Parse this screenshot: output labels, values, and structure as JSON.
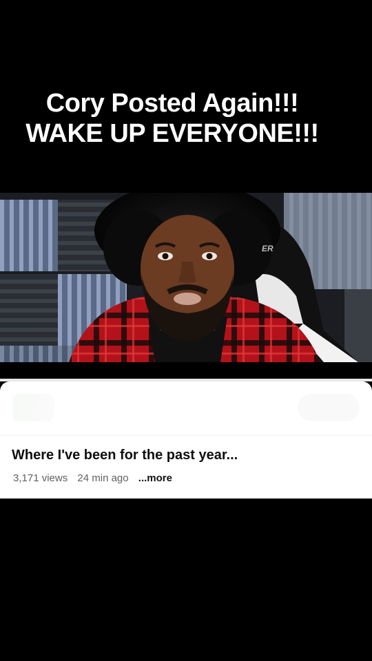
{
  "overlay_caption": {
    "line1": "Cory Posted Again!!!",
    "line2": "WAKE UP EVERYONE!!!"
  },
  "thumbnail": {
    "chair_brand_fragment": "ER"
  },
  "video": {
    "title": "Where I've been for the past year...",
    "views": "3,171 views",
    "age": "24 min ago",
    "more_label": "...more"
  },
  "colors": {
    "background": "#000000",
    "card": "#ffffff",
    "title_text": "#0f0f0f",
    "meta_text": "#606060",
    "shirt_red": "#c0141c"
  }
}
